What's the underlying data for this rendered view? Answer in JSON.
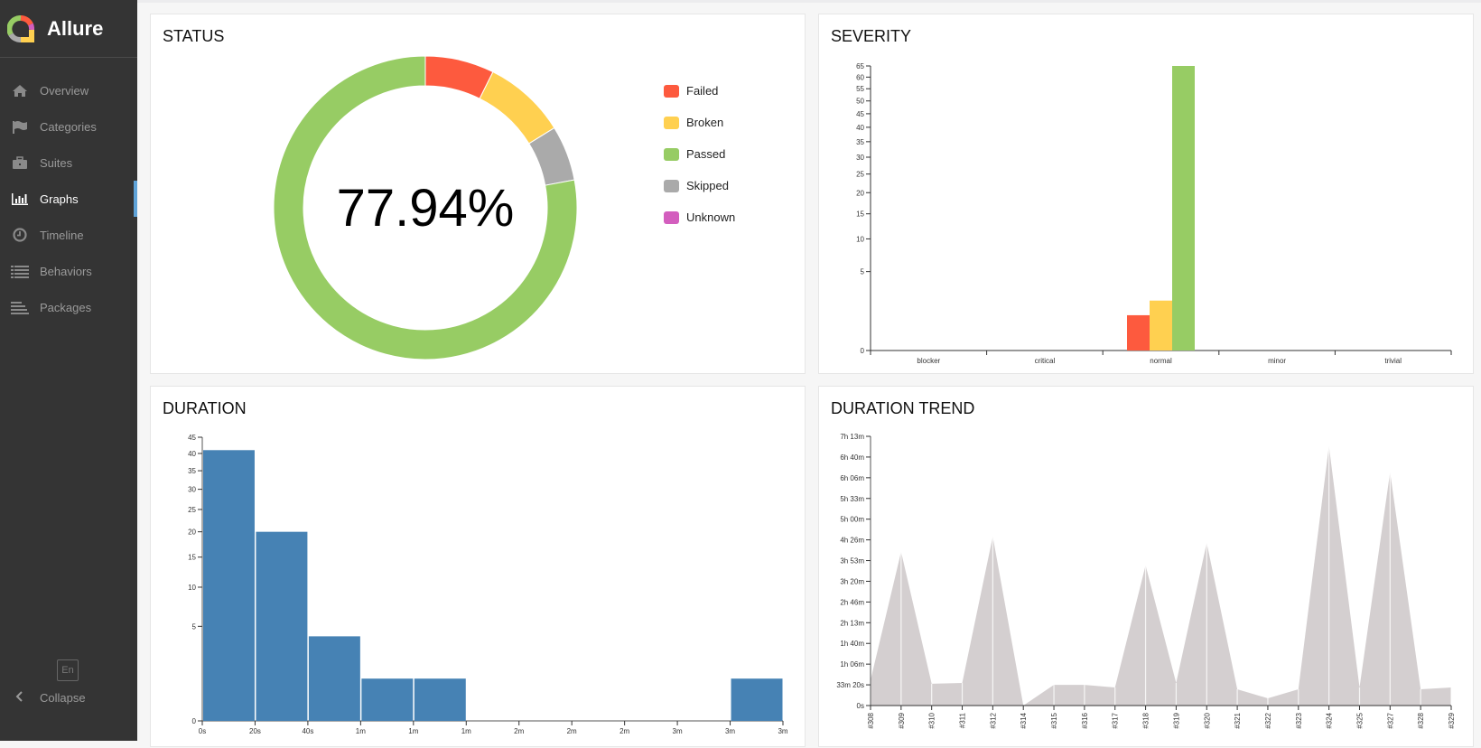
{
  "app": {
    "name": "Allure",
    "lang_button": "En",
    "collapse_label": "Collapse"
  },
  "sidebar": {
    "items": [
      {
        "label": "Overview",
        "icon": "home-icon",
        "active": false
      },
      {
        "label": "Categories",
        "icon": "flag-icon",
        "active": false
      },
      {
        "label": "Suites",
        "icon": "briefcase-icon",
        "active": false
      },
      {
        "label": "Graphs",
        "icon": "bar-chart-icon",
        "active": true
      },
      {
        "label": "Timeline",
        "icon": "clock-icon",
        "active": false
      },
      {
        "label": "Behaviors",
        "icon": "list-icon",
        "active": false
      },
      {
        "label": "Packages",
        "icon": "align-left-icon",
        "active": false
      }
    ]
  },
  "colors": {
    "failed": "#fd5a3e",
    "broken": "#ffd050",
    "passed": "#97cc64",
    "skipped": "#aaaaaa",
    "unknown": "#d35ebe",
    "duration_bar": "#4682b4",
    "trend_area": "#d4cfd0"
  },
  "chart_data": [
    {
      "id": "status",
      "type": "pie",
      "title": "STATUS",
      "center_label": "77.94%",
      "slices": [
        {
          "name": "Failed",
          "value": 5
        },
        {
          "name": "Broken",
          "value": 6
        },
        {
          "name": "Skipped",
          "value": 4
        },
        {
          "name": "Passed",
          "value": 53
        },
        {
          "name": "Unknown",
          "value": 0
        }
      ],
      "legend": [
        "Failed",
        "Broken",
        "Passed",
        "Skipped",
        "Unknown"
      ],
      "legend_position": "right"
    },
    {
      "id": "severity",
      "type": "bar",
      "title": "SEVERITY",
      "scale": "sqrt",
      "categories": [
        "blocker",
        "critical",
        "normal",
        "minor",
        "trivial"
      ],
      "series": [
        {
          "name": "Failed",
          "values": [
            0,
            0,
            1,
            0,
            0
          ]
        },
        {
          "name": "Broken",
          "values": [
            0,
            0,
            2,
            0,
            0
          ]
        },
        {
          "name": "Passed",
          "values": [
            0,
            0,
            65,
            0,
            0
          ]
        }
      ],
      "yticks": [
        0,
        5,
        10,
        15,
        20,
        25,
        30,
        35,
        40,
        45,
        50,
        55,
        60,
        65
      ],
      "ylim": [
        0,
        65
      ]
    },
    {
      "id": "duration",
      "type": "bar",
      "title": "DURATION",
      "scale": "sqrt",
      "xtick_labels": [
        "0s",
        "20s",
        "40s",
        "1m",
        "1m",
        "1m",
        "2m",
        "2m",
        "2m",
        "3m",
        "3m",
        "3m"
      ],
      "bins": [
        41,
        20,
        4,
        1,
        1,
        0,
        0,
        0,
        0,
        0,
        1
      ],
      "yticks": [
        0,
        5,
        10,
        15,
        20,
        25,
        30,
        35,
        40,
        45
      ],
      "ylim": [
        0,
        45
      ]
    },
    {
      "id": "duration-trend",
      "type": "area",
      "title": "DURATION TREND",
      "x": [
        "#308",
        "#309",
        "#310",
        "#311",
        "#312",
        "#314",
        "#315",
        "#316",
        "#317",
        "#318",
        "#319",
        "#320",
        "#321",
        "#322",
        "#323",
        "#324",
        "#325",
        "#327",
        "#328",
        "#329"
      ],
      "values_seconds": [
        2450,
        14850,
        2100,
        2180,
        16330,
        0,
        2000,
        2000,
        1750,
        13540,
        2180,
        15720,
        1570,
        700,
        1570,
        25070,
        1750,
        22530,
        1570,
        1750
      ],
      "ytick_labels": [
        "0s",
        "33m 20s",
        "1h 06m",
        "1h 40m",
        "2h 13m",
        "2h 46m",
        "3h 20m",
        "3h 53m",
        "4h 26m",
        "5h 00m",
        "5h 33m",
        "6h 06m",
        "6h 40m",
        "7h 13m"
      ],
      "ylim_seconds": [
        0,
        26000
      ]
    }
  ]
}
